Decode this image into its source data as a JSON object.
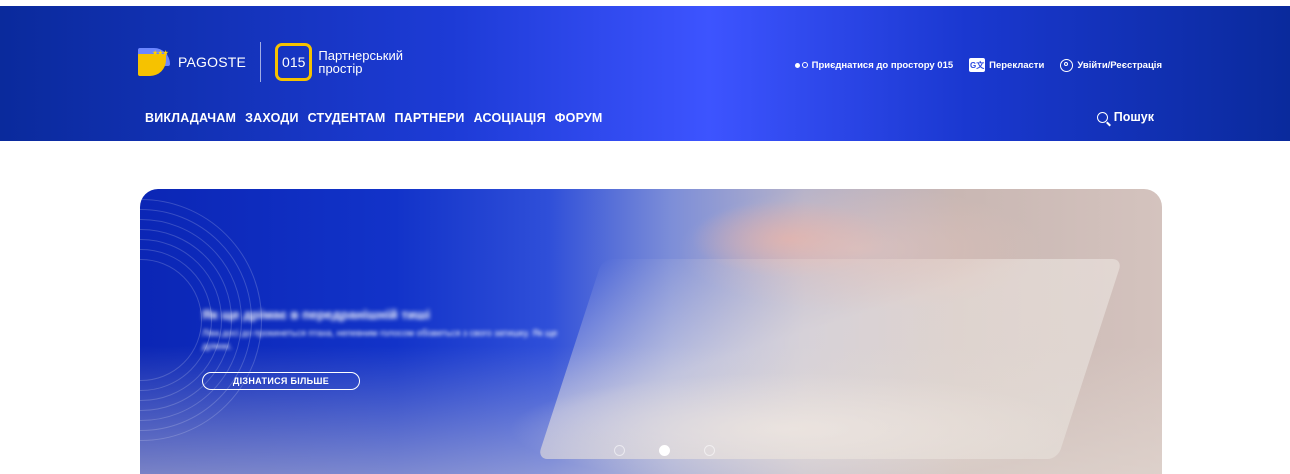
{
  "header": {
    "brand_name": "PAGOSTE",
    "code": "015",
    "partner_space": "Партнерський простір",
    "top_links": {
      "join": "Приєднатися до простору 015",
      "translate": "Перекласти",
      "login": "Увійти/Реєстрація"
    },
    "nav": [
      "ВИКЛАДАЧАМ",
      "ЗАХОДИ",
      "СТУДЕНТАМ",
      "ПАРТНЕРИ",
      "АСОЦІАЦІЯ",
      "ФОРУМ"
    ],
    "search_label": "Пошук",
    "icons": {
      "logo": "pagoste-logo-icon",
      "join": "dots-toggle-icon",
      "translate": "translate-icon",
      "login": "user-icon",
      "search": "search-icon"
    },
    "colors": {
      "bar": "#1a38d0",
      "code_border": "#f6c200"
    }
  },
  "hero": {
    "title": "Як ще дрімає в передранішній тиші",
    "description": "Ліва досі до прокинеться птаха, непевним голосом обізветься з свого затишку. Як ще дрімає.",
    "button_label": "ДІЗНАТИСЯ БІЛЬШЕ",
    "slides": {
      "count": 3,
      "active_index": 1
    }
  }
}
